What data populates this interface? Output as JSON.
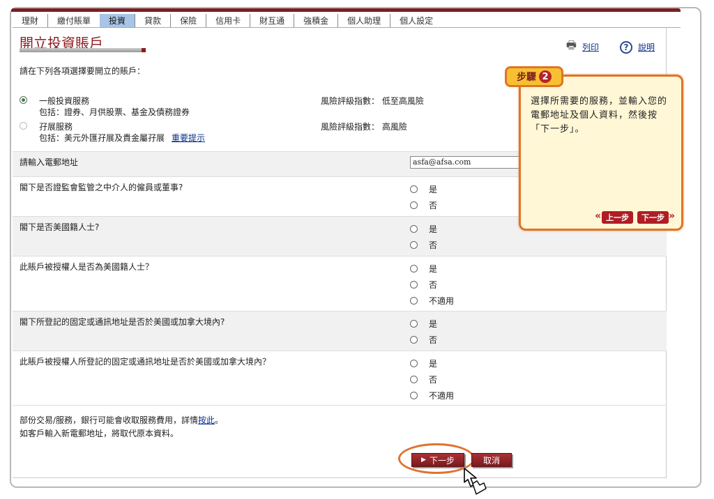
{
  "nav": {
    "items": [
      "理財",
      "繳付賬單",
      "投資",
      "貸款",
      "保險",
      "信用卡",
      "財互通",
      "強積金",
      "個人助理",
      "個人設定"
    ],
    "active_index": 2
  },
  "page": {
    "title": "開立投資賬戶",
    "print_label": "列印",
    "help_label": "說明",
    "help_symbol": "?"
  },
  "form": {
    "intro": "請在下列各項選擇要開立的賬戶：",
    "accounts": [
      {
        "name": "一般投資服務",
        "includes": "包括：證券、月供股票、基金及債務證券",
        "risk": "風險評級指數： 低至高風險",
        "selected": true
      },
      {
        "name": "孖展服務",
        "includes": "包括：美元外匯孖展及貴金屬孖展",
        "link": "重要提示",
        "risk": "風險評級指數： 高風險",
        "selected": false
      }
    ],
    "email_label": "請輸入電郵地址",
    "email_value": "asfa@afsa.com",
    "questions": [
      {
        "text": "閣下是否證監會監管之中介人的僱員或董事?",
        "options": [
          "是",
          "否"
        ]
      },
      {
        "text": "閣下是否美國籍人士?",
        "options": [
          "是",
          "否"
        ]
      },
      {
        "text": "此賬戶被授權人是否為美國籍人士？",
        "options": [
          "是",
          "否",
          "不適用"
        ]
      },
      {
        "text": "閣下所登記的固定或通訊地址是否於美國或加拿大境內?",
        "options": [
          "是",
          "否"
        ]
      },
      {
        "text": "此賬戶被授權人所登記的固定或通訊地址是否於美國或加拿大境內？",
        "options": [
          "是",
          "否",
          "不適用"
        ]
      }
    ],
    "note1_pre": "部份交易/服務，銀行可能會收取服務費用，詳情",
    "note1_link": "按此",
    "note1_post": "。",
    "note2": "如客戶輸入新電郵地址，將取代原本資料。",
    "next_label": "下一步",
    "cancel_label": "取消"
  },
  "callout": {
    "step_label": "步驟",
    "step_number": "2",
    "text": "選擇所需要的服務，並輸入您的電郵地址及個人資料，然後按「下一步」。",
    "prev_label": "上一步",
    "next_label": "下一步"
  },
  "colors": {
    "brand": "#7b1f23",
    "accent": "#e07428",
    "active_tab": "#a8c4e6"
  }
}
